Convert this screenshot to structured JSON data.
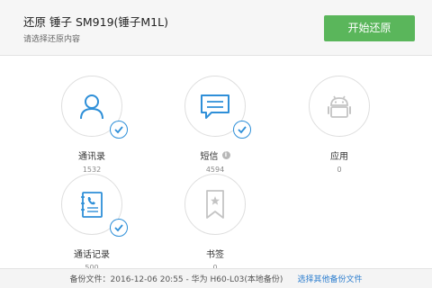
{
  "header": {
    "title": "还原 锤子 SM919(锤子M1L)",
    "subtitle": "请选择还原内容",
    "start_button": "开始还原"
  },
  "categories": [
    {
      "label": "通讯录",
      "count": "1532",
      "icon": "contact-person-icon",
      "selected": true,
      "info": false
    },
    {
      "label": "短信",
      "count": "4594",
      "icon": "message-bubble-icon",
      "selected": true,
      "info": true
    },
    {
      "label": "应用",
      "count": "0",
      "icon": "android-icon",
      "selected": false,
      "info": false
    },
    {
      "label": "通话记录",
      "count": "500",
      "icon": "call-log-icon",
      "selected": true,
      "info": false
    },
    {
      "label": "书签",
      "count": "0",
      "icon": "bookmark-icon",
      "selected": false,
      "info": false
    }
  ],
  "footer": {
    "backup_file": "备份文件：2016-12-06 20:55 - 华为 H60-L03(本地备份)",
    "other_backup_link": "选择其他备份文件"
  },
  "colors": {
    "accent_blue": "#2e8fd8",
    "button_green": "#5ab65b",
    "disabled_gray": "#c4c4c4"
  }
}
